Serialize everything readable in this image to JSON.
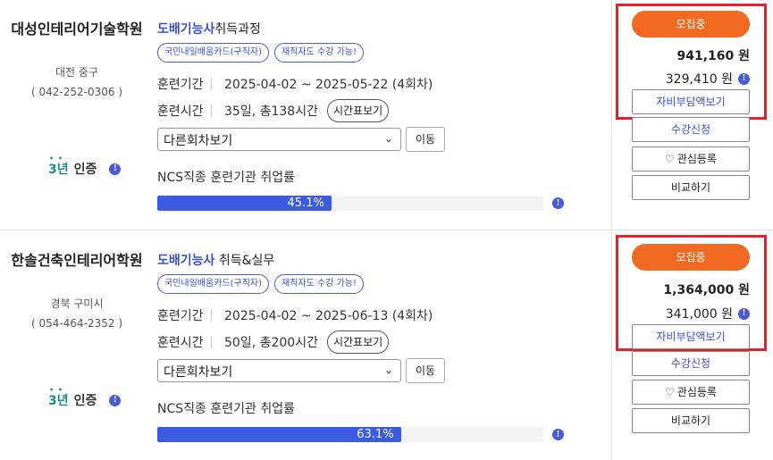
{
  "cards": [
    {
      "institution": "대성인테리어기술학원",
      "location": "대전 중구",
      "phone": "( 042-252-0306 )",
      "cert_years": "3년",
      "cert_label": "인증",
      "course_highlight": "도배기능사",
      "course_rest": "취득과정",
      "tags": [
        "국민내일배움카드(구직자)",
        "재직자도 수강 가능!"
      ],
      "period_label": "훈련기간",
      "period_value": "2025-04-02 ~ 2025-05-22 (4회차)",
      "hours_label": "훈련시간",
      "hours_value": "35일, 총138시간",
      "schedule_button": "시간표보기",
      "session_select": "다른회차보기",
      "move_button": "이동",
      "employment_label": "NCS직종 훈련기관 취업률",
      "employment_rate": 45.1,
      "employment_text": "45.1%",
      "status_button": "모집중",
      "price_total": "941,160 원",
      "price_self": "329,410 원",
      "self_pay_button": "자비부담액보기",
      "apply_button": "수강신청",
      "favorite_button": "관심등록",
      "compare_button": "비교하기"
    },
    {
      "institution": "한솔건축인테리어학원",
      "location": "경북 구미시",
      "phone": "( 054-464-2352 )",
      "cert_years": "3년",
      "cert_label": "인증",
      "course_highlight": "도배기능사",
      "course_rest": " 취득&실무",
      "tags": [
        "국민내일배움카드(구직자)",
        "재직자도 수강 가능!"
      ],
      "period_label": "훈련기간",
      "period_value": "2025-04-02 ~ 2025-06-13 (4회차)",
      "hours_label": "훈련시간",
      "hours_value": "50일, 총200시간",
      "schedule_button": "시간표보기",
      "session_select": "다른회차보기",
      "move_button": "이동",
      "employment_label": "NCS직종 훈련기관 취업률",
      "employment_rate": 63.1,
      "employment_text": "63.1%",
      "status_button": "모집중",
      "price_total": "1,364,000 원",
      "price_self": "341,000 원",
      "self_pay_button": "자비부담액보기",
      "apply_button": "수강신청",
      "favorite_button": "관심등록",
      "compare_button": "비교하기"
    }
  ],
  "colors": {
    "accent_blue": "#3b5be0",
    "recruit_orange": "#f26a21",
    "highlight_red": "#e8202a",
    "cert_teal": "#1f8a8a"
  },
  "icons": {
    "info": "info-icon",
    "heart": "heart-icon",
    "dropdown": "chevron-down-icon"
  }
}
